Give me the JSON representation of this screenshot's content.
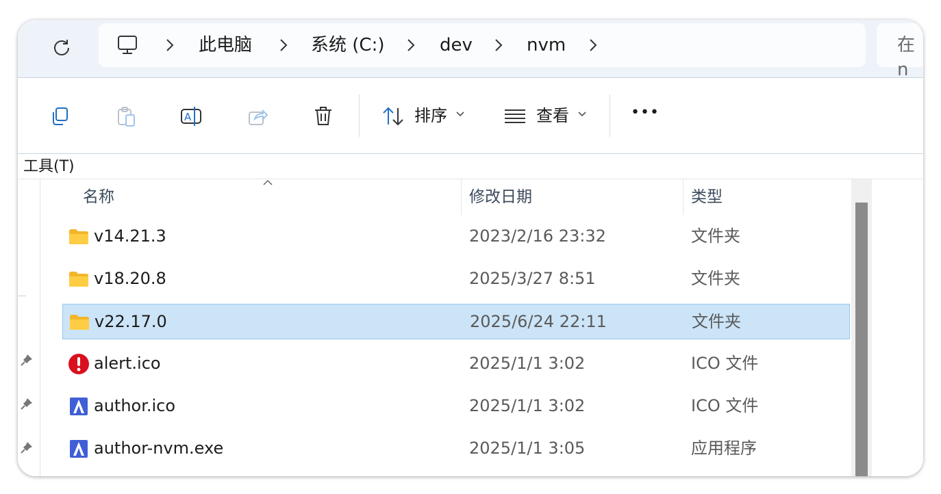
{
  "breadcrumb": {
    "items": [
      "此电脑",
      "系统 (C:)",
      "dev",
      "nvm"
    ]
  },
  "search": {
    "placeholder": "在 n"
  },
  "toolbar": {
    "sort_label": "排序",
    "view_label": "查看",
    "more_label": "•••"
  },
  "menu": {
    "tools_label": "工具(T)"
  },
  "columns": {
    "name": "名称",
    "modified": "修改日期",
    "type": "类型"
  },
  "files": [
    {
      "name": "v14.21.3",
      "modified": "2023/2/16 23:32",
      "type": "文件夹",
      "icon": "folder-icon",
      "selected": false
    },
    {
      "name": "v18.20.8",
      "modified": "2025/3/27 8:51",
      "type": "文件夹",
      "icon": "folder-icon",
      "selected": false
    },
    {
      "name": "v22.17.0",
      "modified": "2025/6/24 22:11",
      "type": "文件夹",
      "icon": "folder-icon",
      "selected": true
    },
    {
      "name": "alert.ico",
      "modified": "2025/1/1 3:02",
      "type": "ICO 文件",
      "icon": "alert-icon",
      "selected": false
    },
    {
      "name": "author.ico",
      "modified": "2025/1/1 3:02",
      "type": "ICO 文件",
      "icon": "author-icon",
      "selected": false
    },
    {
      "name": "author-nvm.exe",
      "modified": "2025/1/1 3:05",
      "type": "应用程序",
      "icon": "author-icon",
      "selected": false
    }
  ],
  "colors": {
    "selection": "#cce4f7",
    "topbar": "#eef3f9",
    "alert": "#d9101f",
    "author": "#3f5fd6",
    "folder": "#ffcd44"
  }
}
